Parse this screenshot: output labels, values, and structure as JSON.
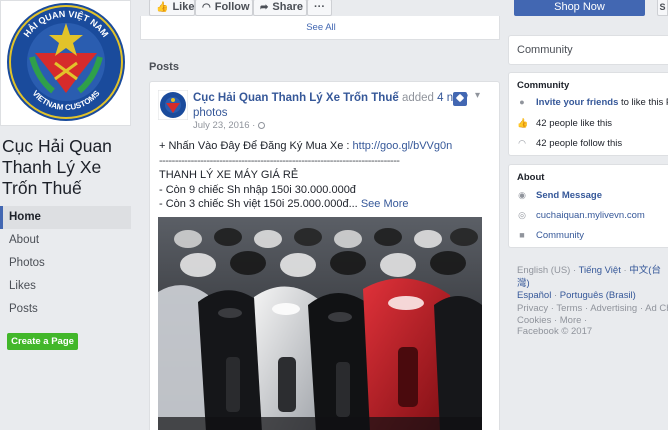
{
  "page": {
    "name": "Cục Hải Quan Thanh Lý Xe Trốn Thuế",
    "emblem_text_top": "HẢI QUAN VIỆT NAM",
    "emblem_text_bottom": "VIETNAM CUSTOMS"
  },
  "nav": {
    "items": [
      {
        "label": "Home",
        "active": true
      },
      {
        "label": "About"
      },
      {
        "label": "Photos"
      },
      {
        "label": "Likes"
      },
      {
        "label": "Posts"
      }
    ],
    "create_page_label": "Create a Page"
  },
  "action_bar": {
    "like_label": "Like",
    "follow_label": "Follow",
    "share_label": "Share",
    "more_label": "···",
    "shop_now_label": "Shop Now",
    "share_corner_label": "S"
  },
  "top_card": {
    "see_all_label": "See All"
  },
  "posts": {
    "heading": "Posts",
    "post": {
      "author": "Cục Hải Quan Thanh Lý Xe Trốn Thuế",
      "action": "added",
      "action_link": "4 new photos",
      "date": "July 23, 2016 ·",
      "line1_prefix": "+ Nhấn Vào Đây Để Đăng Ký Mua Xe : ",
      "line1_link": "http://goo.gl/bVVg0n",
      "separator": "----------------------------------------------------------------------------",
      "line3": "THANH LÝ XE MÁY GIÁ RẺ",
      "line4": "- Còn 9 chiếc Sh nhập 150i 30.000.000đ",
      "line5": "- Còn 3 chiếc Sh việt 150i 25.000.000đ...",
      "see_more": "See More"
    }
  },
  "sidebar": {
    "community_header": "Community",
    "community_card": {
      "title": "Community",
      "invite_link": "Invite your friends",
      "invite_suffix": " to like this Page",
      "likes": "42 people like this",
      "follows": "42 people follow this"
    },
    "about_card": {
      "title": "About",
      "send_message": "Send Message",
      "website": "cuchaiquan.mylivevn.com",
      "category": "Community"
    },
    "languages": {
      "current": "English (US) ·",
      "items": [
        "Tiếng Việt",
        "中文(台灣)",
        "Español",
        "Português (Brasil)"
      ]
    },
    "footer": {
      "line1": "Privacy · Terms · Advertising · Ad Choices ·",
      "line2": "Cookies · More ·",
      "line3": "Facebook © 2017"
    }
  },
  "colors": {
    "facebook_blue": "#4267b2",
    "link_blue": "#365899",
    "green": "#42b72a",
    "background": "#e9ebee"
  }
}
